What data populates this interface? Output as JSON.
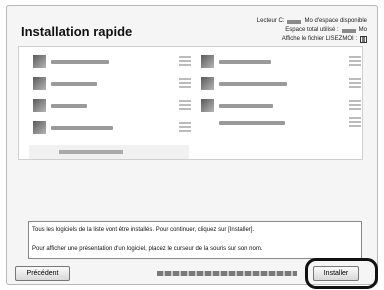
{
  "title": "Installation rapide",
  "info": {
    "drive_prefix": "Lecteur C:",
    "drive_suffix": "Mo d'espace disponible",
    "total_prefix": "Espace total utilisé :",
    "total_suffix": "Mo",
    "readme": "Affiche le fichier LISEZMOI :",
    "readme_icon": "book-icon"
  },
  "description": {
    "line1": "Tous les logiciels de la liste vont être installés. Pour continuer, cliquez sur [Installer].",
    "line2": "Pour afficher une présentation d'un logiciel, placez le curseur de la souris sur son nom."
  },
  "buttons": {
    "previous": "Précédent",
    "install": "Installer"
  },
  "colors": {
    "highlight": "#111111",
    "window_bg": "#f5f5f5"
  }
}
